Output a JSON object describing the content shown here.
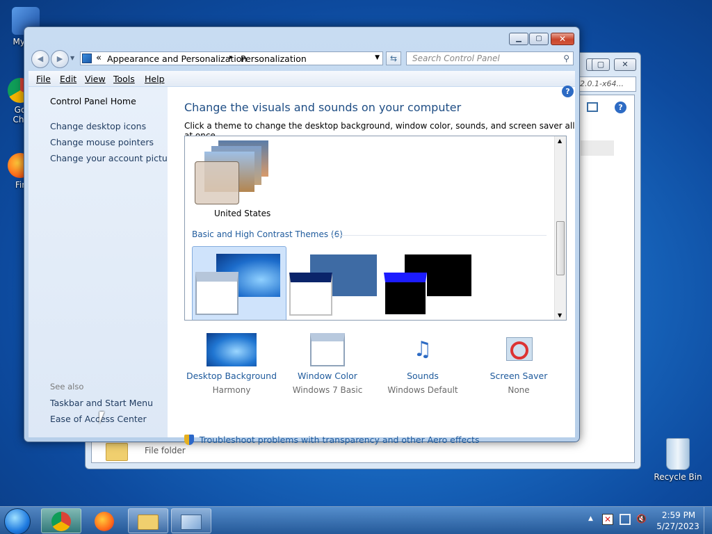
{
  "desktop": {
    "icons": [
      {
        "label": "My Co"
      },
      {
        "label": "Go\nChr"
      },
      {
        "label": "Fir"
      },
      {
        "label": "Recycle Bin"
      }
    ]
  },
  "background_window": {
    "search_text": "2.0.1-x64...",
    "file_label": "File folder"
  },
  "window": {
    "caption_minimize": "▁",
    "caption_maximize": "▢",
    "caption_close": "✕",
    "breadcrumb": {
      "root_glyph": "«",
      "item1": "Appearance and Personalization",
      "separator": "▸",
      "item2": "Personalization"
    },
    "search_placeholder": "Search Control Panel",
    "menu": [
      "File",
      "Edit",
      "View",
      "Tools",
      "Help"
    ]
  },
  "sidebar": {
    "home": "Control Panel Home",
    "links": [
      "Change desktop icons",
      "Change mouse pointers",
      "Change your account picture"
    ],
    "see_also_heading": "See also",
    "see_also": [
      "Taskbar and Start Menu",
      "Ease of Access Center"
    ]
  },
  "content": {
    "title": "Change the visuals and sounds on your computer",
    "subtitle": "Click a theme to change the desktop background, window color, sounds, and screen saver all at once.",
    "theme_united_states": "United States",
    "basic_group_label": "Basic and High Contrast Themes (6)",
    "bottom_items": [
      {
        "label": "Desktop Background",
        "value": "Harmony"
      },
      {
        "label": "Window Color",
        "value": "Windows 7 Basic"
      },
      {
        "label": "Sounds",
        "value": "Windows Default"
      },
      {
        "label": "Screen Saver",
        "value": "None"
      }
    ],
    "troubleshoot": "Troubleshoot problems with transparency and other Aero effects"
  },
  "taskbar": {
    "time": "2:59 PM",
    "date": "5/27/2023"
  },
  "colors": {
    "link": "#1e5a9c",
    "heading": "#1e4d84",
    "close_button": "#c9462c",
    "selected_theme": "#cfe3fb"
  }
}
